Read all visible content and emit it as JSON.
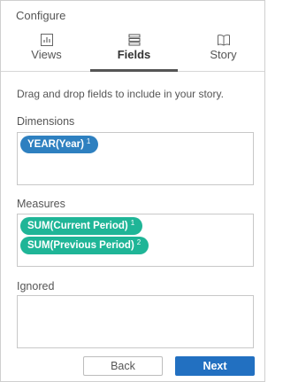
{
  "header": {
    "title": "Configure"
  },
  "tabs": [
    {
      "label": "Views",
      "icon": "chart-icon",
      "active": false
    },
    {
      "label": "Fields",
      "icon": "stack-icon",
      "active": true
    },
    {
      "label": "Story",
      "icon": "book-icon",
      "active": false
    }
  ],
  "instructions": "Drag and drop fields to include in your story.",
  "dimensions": {
    "label": "Dimensions",
    "fields": [
      {
        "name": "YEAR(Year)",
        "index": "1"
      }
    ]
  },
  "measures": {
    "label": "Measures",
    "fields": [
      {
        "name": "SUM(Current Period)",
        "index": "1"
      },
      {
        "name": "SUM(Previous Period)",
        "index": "2"
      }
    ]
  },
  "ignored": {
    "label": "Ignored",
    "fields": []
  },
  "buttons": {
    "back": "Back",
    "next": "Next"
  },
  "colors": {
    "dimension_pill": "#2e80c0",
    "measure_pill": "#1fb597",
    "primary_button": "#2270c1"
  }
}
